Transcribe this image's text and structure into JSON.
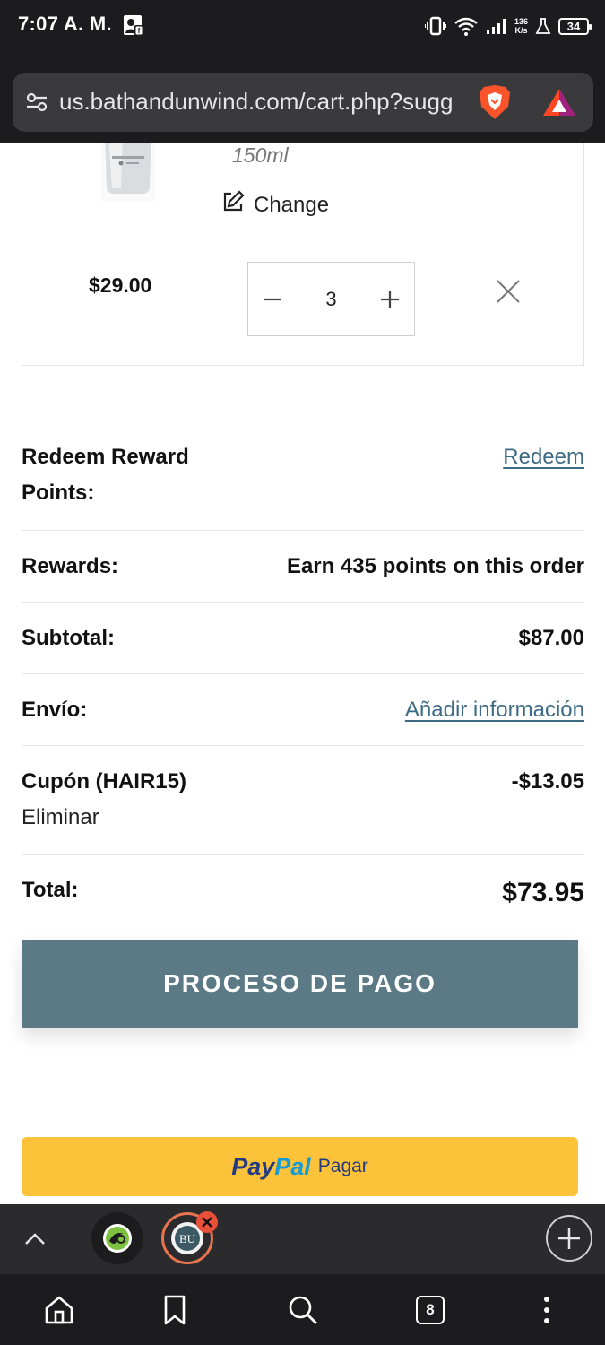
{
  "status_bar": {
    "time": "7:07 A. M.",
    "net_speed_value": "136",
    "net_speed_unit": "K/s",
    "battery": "34",
    "icons": [
      "notification-icon",
      "vibrate-icon",
      "wifi-icon",
      "signal-icon",
      "lab-icon",
      "battery-icon"
    ]
  },
  "browser": {
    "url": "us.bathandunwind.com/cart.php?sugg",
    "icons": [
      "site-settings-icon",
      "brave-shields-icon",
      "brave-rewards-icon"
    ]
  },
  "cart_item": {
    "variant": "150ml",
    "change_label": "Change",
    "price": "$29.00",
    "quantity": "3"
  },
  "summary": {
    "redeem_label": "Redeem Reward Points:",
    "redeem_link": "Redeem",
    "rewards_label": "Rewards:",
    "rewards_value": "Earn 435 points on this order",
    "subtotal_label": "Subtotal:",
    "subtotal_value": "$87.00",
    "shipping_label": "Envío:",
    "shipping_link": "Añadir información",
    "coupon_label": "Cupón (HAIR15)",
    "coupon_remove": "Eliminar",
    "coupon_value": "-$13.05",
    "total_label": "Total:",
    "total_value": "$73.95"
  },
  "checkout": {
    "label": "PROCESO DE PAGO"
  },
  "paypal": {
    "logo_part1": "Pay",
    "logo_part2": "Pal",
    "label": "Pagar"
  },
  "tab_strip": {
    "tab2_initials": "BU"
  },
  "bottom_nav": {
    "tabs_count": "8"
  },
  "colors": {
    "checkout_button": "#5b7a85",
    "paypal_button": "#fcc33a",
    "link": "#3d6a84",
    "chrome": "#1c1c1e"
  }
}
